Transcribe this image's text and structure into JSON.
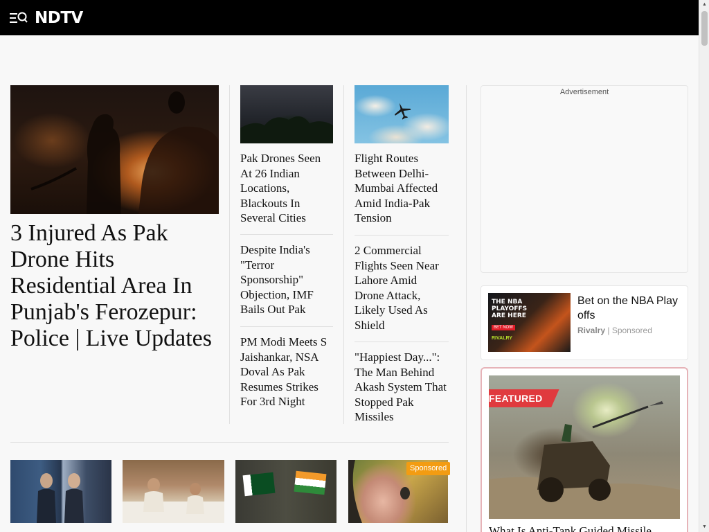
{
  "header": {
    "logo_text": "NDTV",
    "menu_icon": "menu-search-icon",
    "background": "#000000",
    "brand_accent": "#e8112d"
  },
  "lead_story": {
    "title": "3 Injured As Pak Drone Hits Residential Area In Punjab's Ferozepur: Police | Live Updates",
    "image_icon": "fire-scene-image"
  },
  "stories_col1": [
    {
      "title": "Pak Drones Seen At 26 Indian Locations, Blackouts In Several Cities",
      "image_icon": "night-sky-image"
    },
    {
      "title": "Despite India's \"Terror Sponsorship\" Objection, IMF Bails Out Pak"
    },
    {
      "title": "PM Modi Meets S Jaishankar, NSA Doval As Pak Resumes Strikes For 3rd Night"
    }
  ],
  "stories_col2": [
    {
      "title": "Flight Routes Between Delhi-Mumbai Affected Amid India-Pak Tension",
      "image_icon": "airplane-sky-image"
    },
    {
      "title": "2 Commercial Flights Seen Near Lahore Amid Drone Attack, Likely Used As Shield"
    },
    {
      "title": "\"Happiest Day...\": The Man Behind Akash System That Stopped Pak Missiles"
    }
  ],
  "bottom_row": [
    {
      "title": "",
      "image_icon": "leaders-handshake-image"
    },
    {
      "title": "",
      "image_icon": "meeting-room-image"
    },
    {
      "title": "",
      "image_icon": "pakistan-india-flags-image"
    },
    {
      "title": "",
      "image_icon": "sponsored-portrait-image",
      "badge": "Sponsored",
      "badge_color": "#f39c12"
    }
  ],
  "sidebar": {
    "ad_label": "Advertisement",
    "sponsored_card": {
      "title": "Bet on the NBA Play offs",
      "source": "Rivalry",
      "separator": " | ",
      "label": "Sponsored",
      "image_text": "THE NBA PLAYOFFS ARE HERE",
      "image_cta": "BET NOW",
      "image_brand": "RIVALRY"
    },
    "featured_card": {
      "tag": "FEATURED",
      "tag_color": "#e03a3e",
      "title": "What Is Anti-Tank Guided Missile",
      "image_icon": "missile-launch-image"
    }
  }
}
